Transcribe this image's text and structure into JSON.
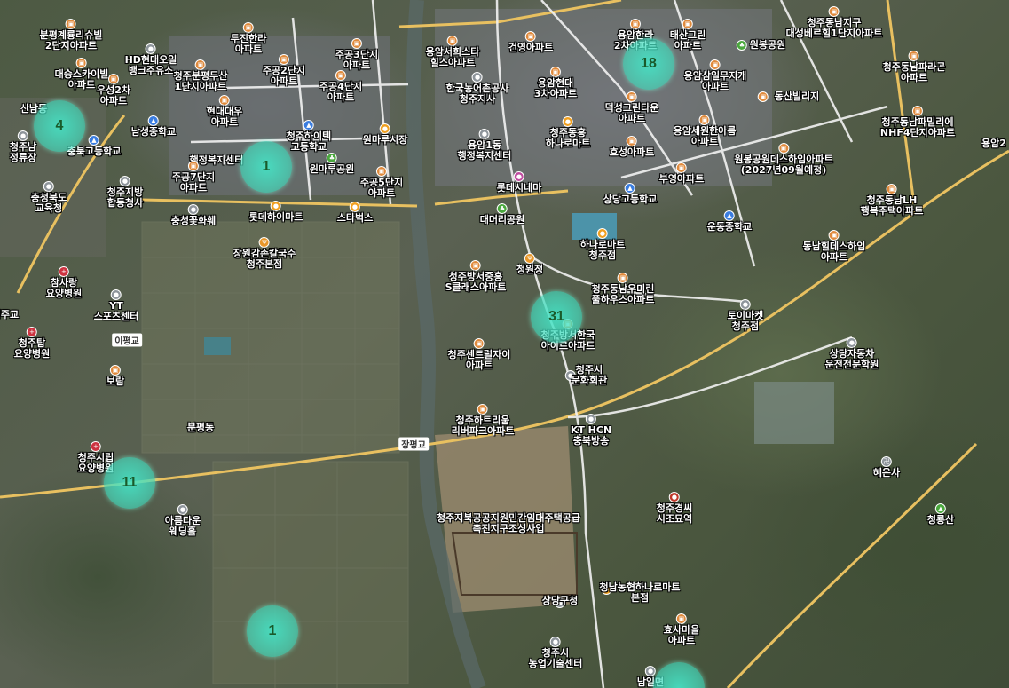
{
  "clusters": [
    {
      "count": "4"
    },
    {
      "count": "1"
    },
    {
      "count": "18"
    },
    {
      "count": "31"
    },
    {
      "count": "11"
    },
    {
      "count": "1"
    },
    {
      "count": ""
    }
  ],
  "road_labels": [
    "장평교",
    "이평교"
  ],
  "area_labels": [
    "분평동",
    "행정복지센터",
    "산남동",
    "청주교"
  ],
  "pois": [
    {
      "icon": "apartment-icon",
      "name": "분평계룡리슈빌\n2단지아파트"
    },
    {
      "icon": "apartment-icon",
      "name": "대승스카이빌\n아파트"
    },
    {
      "icon": "apartment-icon",
      "name": "우성2차\n아파트"
    },
    {
      "icon": "government-icon",
      "name": "HD현대오일\n뱅크주유소"
    },
    {
      "icon": "apartment-icon",
      "name": "두진한라\n아파트"
    },
    {
      "icon": "apartment-icon",
      "name": "청주분평두산\n1단지아파트"
    },
    {
      "icon": "apartment-icon",
      "name": "주공2단지\n아파트"
    },
    {
      "icon": "apartment-icon",
      "name": "주공3단지\n아파트"
    },
    {
      "icon": "apartment-icon",
      "name": "주공4단지\n아파트"
    },
    {
      "icon": "apartment-icon",
      "name": "현대대우\n아파트"
    },
    {
      "icon": "school-icon",
      "name": "남성중학교"
    },
    {
      "icon": "school-icon",
      "name": "청주하이텍\n고등학교"
    },
    {
      "icon": "shop-icon",
      "name": "원마루시장"
    },
    {
      "icon": "school-icon",
      "name": "충북고등학교"
    },
    {
      "icon": "apartment-icon",
      "name": "청주남\n정류장"
    },
    {
      "icon": "apartment-icon",
      "name": "주공7단지\n아파트"
    },
    {
      "icon": "park-icon",
      "name": "원마루공원"
    },
    {
      "icon": "apartment-icon",
      "name": "주공5단지\n아파트"
    },
    {
      "icon": "government-icon",
      "name": "청주지방\n합동청사"
    },
    {
      "icon": "government-icon",
      "name": "충청북도\n교육청"
    },
    {
      "icon": "government-icon",
      "name": "충청꽃화훼"
    },
    {
      "icon": "shop-icon",
      "name": "롯데하이마트"
    },
    {
      "icon": "shop-icon",
      "name": "스타벅스"
    },
    {
      "icon": "food-icon",
      "name": "장원감손칼국수\n청주본점"
    },
    {
      "icon": "hospital-icon",
      "name": "참사랑\n요양병원"
    },
    {
      "icon": "government-icon",
      "name": "YT\n스포츠센터"
    },
    {
      "icon": "hospital-icon",
      "name": "청주탑\n요양병원"
    },
    {
      "icon": "apartment-icon",
      "name": "보람"
    },
    {
      "icon": "hospital-icon",
      "name": "청주시립\n요양병원"
    },
    {
      "icon": "government-icon",
      "name": "아름다운\n웨딩홀"
    },
    {
      "icon": "apartment-icon",
      "name": "용암서희스타\n힐스아파트"
    },
    {
      "icon": "apartment-icon",
      "name": "건영아파트"
    },
    {
      "icon": "government-icon",
      "name": "한국농어촌공사\n청주지사"
    },
    {
      "icon": "apartment-icon",
      "name": "용암현대\n3차아파트"
    },
    {
      "icon": "apartment-icon",
      "name": "덕성그린타운\n아파트"
    },
    {
      "icon": "shop-icon",
      "name": "청주동흥\n하나로마트"
    },
    {
      "icon": "apartment-icon",
      "name": "효성아파트"
    },
    {
      "icon": "government-icon",
      "name": "용암1동\n행정복지센터"
    },
    {
      "icon": "culture-icon",
      "name": "롯데시네마"
    },
    {
      "icon": "park-icon",
      "name": "대머리공원"
    },
    {
      "icon": "apartment-icon",
      "name": "용암한라\n2차아파트"
    },
    {
      "icon": "apartment-icon",
      "name": "태산그린\n아파트"
    },
    {
      "icon": "park-icon",
      "name": "원봉공원"
    },
    {
      "icon": "apartment-icon",
      "name": "용암삼일무지개\n아파트"
    },
    {
      "icon": "apartment-icon",
      "name": "용암세원한아름\n아파트"
    },
    {
      "icon": "apartment-icon",
      "name": "동산빌리지"
    },
    {
      "icon": "apartment-icon",
      "name": "부영아파트"
    },
    {
      "icon": "school-icon",
      "name": "상당고등학교"
    },
    {
      "icon": "apartment-icon",
      "name": "청주동남지구\n대성베르힐1단지아파트"
    },
    {
      "icon": "apartment-icon",
      "name": "청주동남파라곤\n아파트"
    },
    {
      "icon": "apartment-icon",
      "name": "청주동남파밀리에\nNHF4단지아파트"
    },
    {
      "icon": "apartment-icon",
      "name": "원봉공원데스하임아파트\n(2027년09월예정)"
    },
    {
      "icon": "apartment-icon",
      "name": "청주동남LH\n행복주택아파트"
    },
    {
      "icon": "school-icon",
      "name": "운동중학교"
    },
    {
      "icon": "apartment-icon",
      "name": "동남힐데스하임\n아파트"
    },
    {
      "icon": "shop-icon",
      "name": "하나로마트\n청주점"
    },
    {
      "icon": "food-icon",
      "name": "청원정"
    },
    {
      "icon": "apartment-icon",
      "name": "청주방서중흥\nS클래스아파트"
    },
    {
      "icon": "apartment-icon",
      "name": "청주동남우미린\n풀하우스아파트"
    },
    {
      "icon": "apartment-icon",
      "name": "청주방서한국\n아이르아파트"
    },
    {
      "icon": "apartment-icon",
      "name": "청주센트럴자이\n아파트"
    },
    {
      "icon": "government-icon",
      "name": "토이마켓\n청주점"
    },
    {
      "icon": "government-icon",
      "name": "상당자동차\n운전전문학원"
    },
    {
      "icon": "government-icon",
      "name": "청주시\n문화회관"
    },
    {
      "icon": "apartment-icon",
      "name": "청주하트리움\n리버파크아파트"
    },
    {
      "icon": "government-icon",
      "name": "KT HCN\n충북방송"
    },
    {
      "icon": "government-icon",
      "name": "혜은사"
    },
    {
      "icon": "hospital-icon",
      "name": "청주경씨\n시조묘역"
    },
    {
      "icon": "park-icon",
      "name": "청룡산"
    },
    {
      "icon": "apartment-icon",
      "name": "청주지북공공지원민간임대주택공급\n촉진지구조성사업"
    },
    {
      "icon": "shop-icon",
      "name": "청남농협하나로마트\n본점"
    },
    {
      "icon": "apartment-icon",
      "name": "효사마을\n아파트"
    },
    {
      "icon": "government-icon",
      "name": "상당구청"
    },
    {
      "icon": "government-icon",
      "name": "청주시\n농업기술센터"
    },
    {
      "icon": "government-icon",
      "name": "남일면"
    },
    {
      "icon": "apartment-icon",
      "name": "용암2"
    }
  ]
}
